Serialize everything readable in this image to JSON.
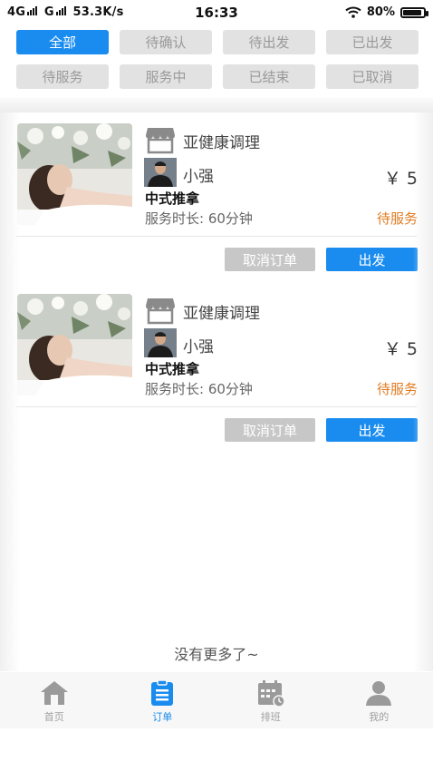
{
  "status_bar": {
    "signal1": "4G",
    "signal2": "G",
    "speed": "53.3K/s",
    "time": "16:33",
    "battery": "80%"
  },
  "tabs": [
    {
      "label": "全部",
      "active": true
    },
    {
      "label": "待确认",
      "active": false
    },
    {
      "label": "待出发",
      "active": false
    },
    {
      "label": "已出发",
      "active": false
    },
    {
      "label": "待服务",
      "active": false
    },
    {
      "label": "服务中",
      "active": false
    },
    {
      "label": "已结束",
      "active": false
    },
    {
      "label": "已取消",
      "active": false
    }
  ],
  "orders": [
    {
      "store_name": "亚健康调理",
      "staff_name": "小强",
      "price": "￥ 5",
      "service_name": "中式推拿",
      "duration": "服务时长: 60分钟",
      "status": "待服务",
      "cancel_label": "取消订单",
      "depart_label": "出发"
    },
    {
      "store_name": "亚健康调理",
      "staff_name": "小强",
      "price": "￥ 5",
      "service_name": "中式推拿",
      "duration": "服务时长: 60分钟",
      "status": "待服务",
      "cancel_label": "取消订单",
      "depart_label": "出发"
    }
  ],
  "footer": {
    "no_more": "没有更多了~"
  },
  "bottom_nav": [
    {
      "label": "首页",
      "icon": "home-icon",
      "active": false
    },
    {
      "label": "订单",
      "icon": "clipboard-icon",
      "active": true
    },
    {
      "label": "排班",
      "icon": "calendar-icon",
      "active": false
    },
    {
      "label": "我的",
      "icon": "user-icon",
      "active": false
    }
  ],
  "colors": {
    "accent": "#1a8cf0",
    "status": "#e07b20",
    "inactive_tab": "#e2e2e2",
    "cancel_button": "#c7c7c7"
  }
}
